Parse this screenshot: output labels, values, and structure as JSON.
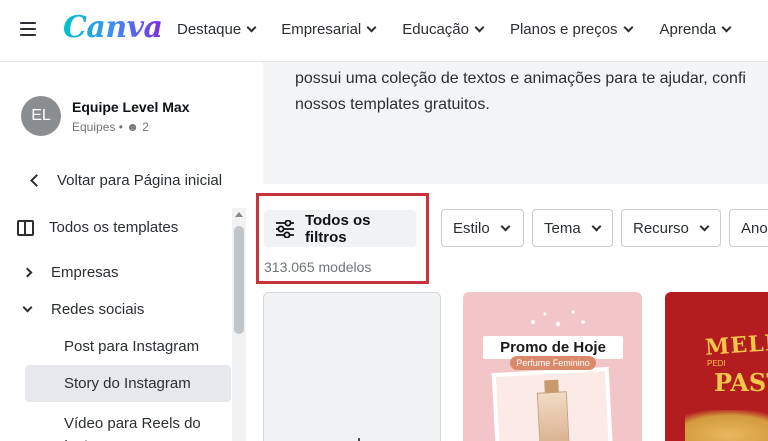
{
  "brand": {
    "logo_text": "Canva"
  },
  "nav": {
    "items": [
      {
        "label": "Destaque"
      },
      {
        "label": "Empresarial"
      },
      {
        "label": "Educação"
      },
      {
        "label": "Planos e preços"
      },
      {
        "label": "Aprenda"
      }
    ]
  },
  "sidebar": {
    "team": {
      "initials": "EL",
      "name": "Equipe Level Max",
      "type": "Equipes",
      "members": "2"
    },
    "back_label": "Voltar para Página inicial",
    "all_templates": "Todos os templates",
    "categories": [
      {
        "label": "Empresas",
        "expanded": false
      },
      {
        "label": "Redes sociais",
        "expanded": true
      }
    ],
    "sub_items": [
      {
        "label": "Post para Instagram",
        "active": false
      },
      {
        "label": "Story do Instagram",
        "active": true
      },
      {
        "label": "Vídeo para Reels do Instagram",
        "active": false
      }
    ]
  },
  "hero": {
    "line1": "possui uma coleção de textos e animações para te ajudar, confi",
    "line2": "nossos templates gratuitos."
  },
  "filters": {
    "all_filters_label": "Todos os filtros",
    "result_count": "313.065 modelos",
    "dropdowns": [
      {
        "label": "Estilo"
      },
      {
        "label": "Tema"
      },
      {
        "label": "Recurso"
      },
      {
        "label": "Ano"
      }
    ]
  },
  "templates": {
    "blank_symbol": "+",
    "promo": {
      "title": "Promo de Hoje",
      "subtitle": "Perfume Feminino"
    },
    "pastel": {
      "top": "MELH",
      "small": "PEDI",
      "big": "PAST"
    }
  },
  "colors": {
    "highlight": "#c8323a",
    "active_bg": "#e6e8eb",
    "accent_start": "#00c4cc",
    "accent_end": "#7d2ae8"
  }
}
